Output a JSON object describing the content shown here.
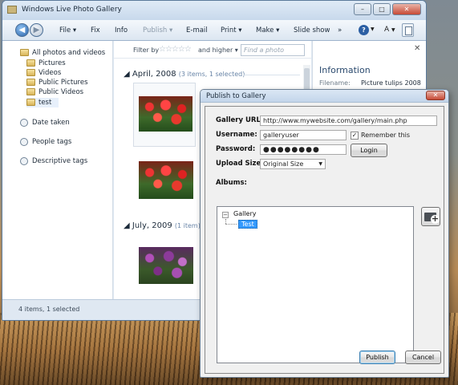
{
  "main_window": {
    "title": "Windows Live Photo Gallery",
    "controls": {
      "minimize": "–",
      "maximize": "□",
      "close": "✕"
    }
  },
  "toolbar": {
    "file": "File ▾",
    "fix": "Fix",
    "info": "Info",
    "publish": "Publish ▾",
    "email": "E-mail",
    "print": "Print ▾",
    "make": "Make ▾",
    "slideshow": "Slide show",
    "more": "»",
    "help": "?",
    "font": "A"
  },
  "nav_pane": {
    "items": [
      {
        "label": "All photos and videos"
      },
      {
        "label": "Pictures"
      },
      {
        "label": "Videos"
      },
      {
        "label": "Public Pictures"
      },
      {
        "label": "Public Videos"
      },
      {
        "label": "test"
      },
      {
        "label": "Date taken"
      },
      {
        "label": "People tags"
      },
      {
        "label": "Descriptive tags"
      }
    ]
  },
  "filter_bar": {
    "filter_by": "Filter by",
    "stars": "☆☆☆☆☆",
    "and_higher": "and higher ▾",
    "find_placeholder": "Find a photo"
  },
  "groups": [
    {
      "title": "April, 2008",
      "count": "(3 items, 1 selected)"
    },
    {
      "title": "July, 2009",
      "count": "(1 item)"
    }
  ],
  "info_pane": {
    "title": "Information",
    "close": "✕",
    "filename_label": "Filename:",
    "filename_value": "Picture tulips 2008"
  },
  "status_bar": {
    "text": "4 items, 1 selected"
  },
  "dialog": {
    "title": "Publish to Gallery",
    "close": "✕",
    "gallery_url_label": "Gallery URL:",
    "gallery_url_value": "http://www.mywebsite.com/gallery/main.php",
    "username_label": "Username:",
    "username_value": "galleryuser",
    "remember_label": "Remember this",
    "remember_checked": "✓",
    "password_label": "Password:",
    "password_value": "●●●●●●●●",
    "login_button": "Login",
    "upload_size_label": "Upload Size:",
    "upload_size_value": "Original Size",
    "albums_label": "Albums:",
    "albums_tree": {
      "root": "Gallery",
      "child": "Test",
      "expander": "−"
    },
    "publish_button": "Publish",
    "cancel_button": "Cancel"
  }
}
